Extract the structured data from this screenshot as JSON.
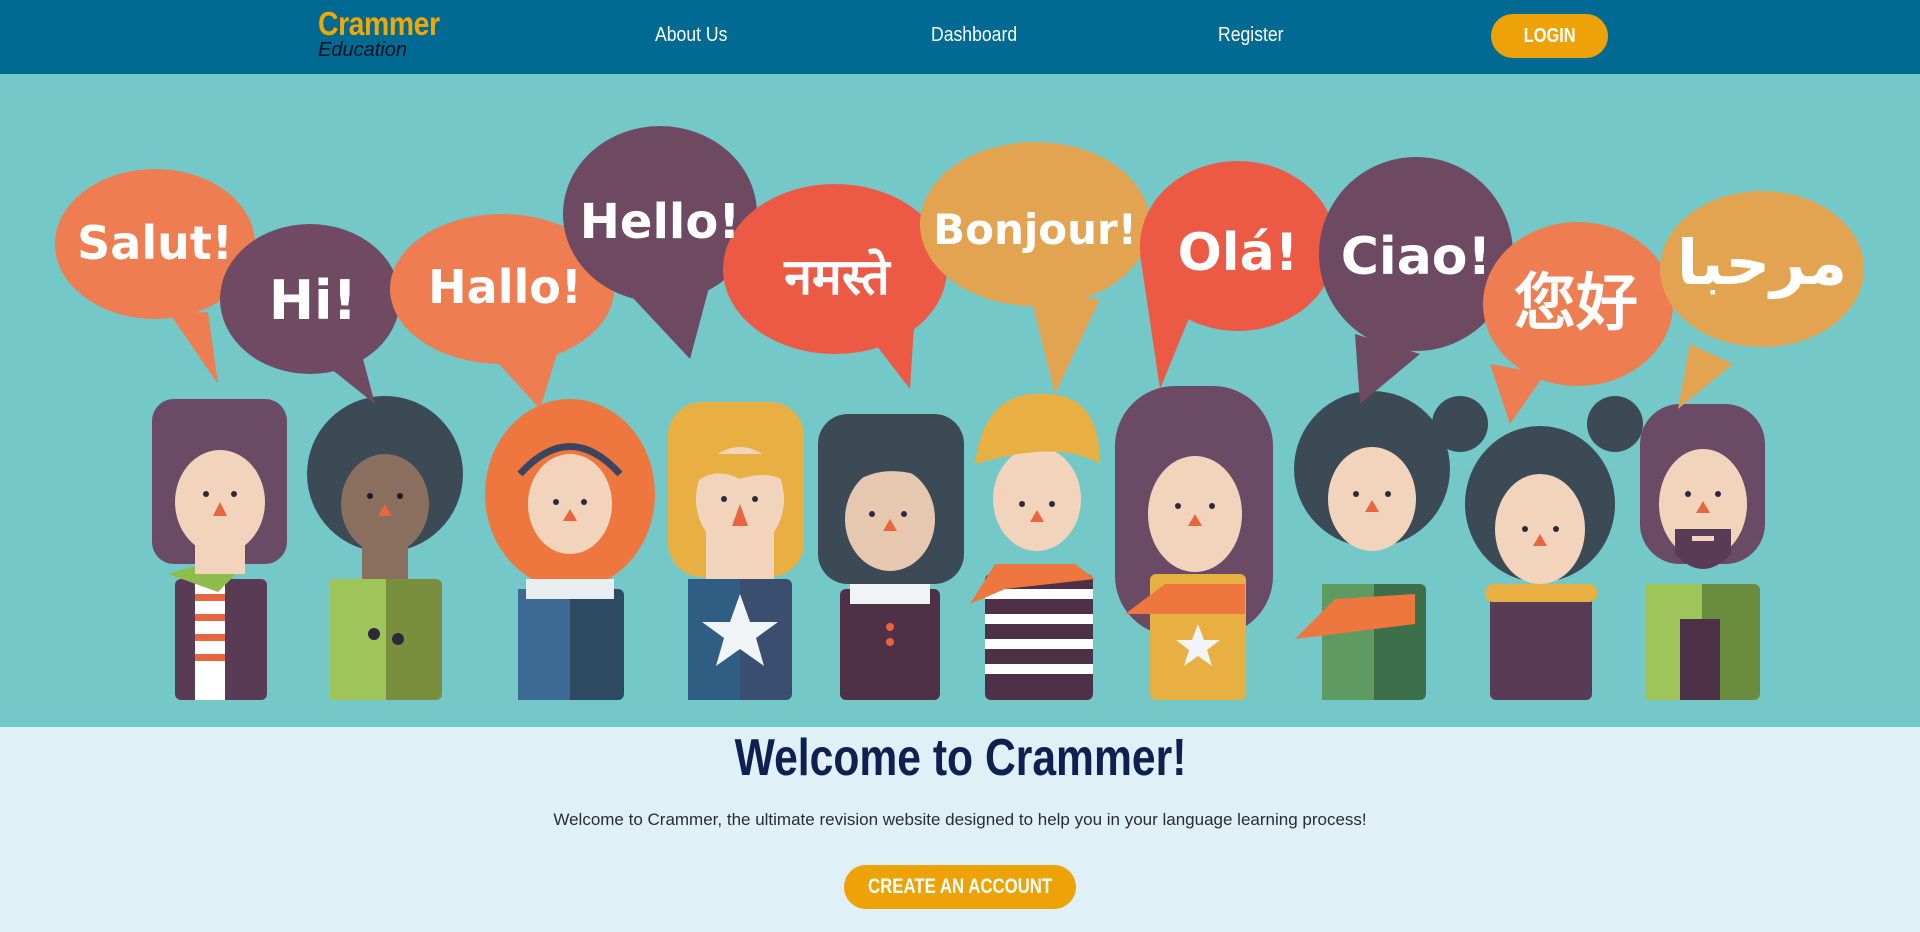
{
  "brand": {
    "name": "Crammer",
    "tagline": "Education"
  },
  "nav": {
    "links": [
      "About Us",
      "Dashboard",
      "Register"
    ],
    "login_label": "LOGIN"
  },
  "hero": {
    "greetings": [
      "Salut!",
      "Hi!",
      "Hallo!",
      "Hello!",
      "नमस्ते",
      "Bonjour!",
      "Olá!",
      "Ciao!",
      "您好",
      "مرحبا"
    ]
  },
  "main": {
    "title": "Welcome to Crammer!",
    "description": "Welcome to Crammer, the ultimate revision website designed to help you in your language learning process!",
    "cta_label": "CREATE AN ACCOUNT"
  },
  "colors": {
    "navbar": "#006a93",
    "accent": "#eda307",
    "hero_bg": "#74c8c8",
    "page_bg": "#dff0f7",
    "title": "#0d2050"
  }
}
